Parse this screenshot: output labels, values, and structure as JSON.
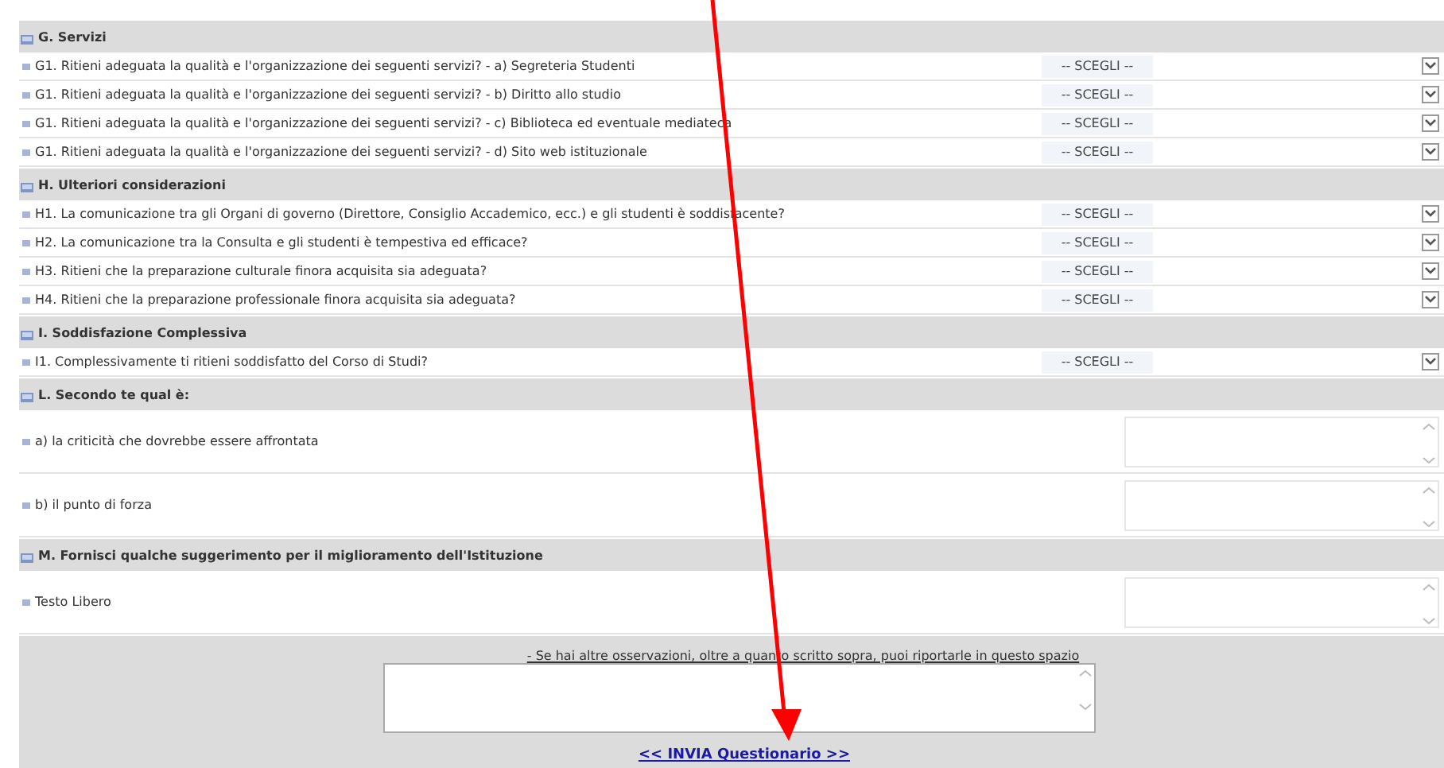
{
  "sections": [
    {
      "title": "G. Servizi",
      "questions": [
        {
          "kind": "select",
          "text": "G1. Ritieni adeguata la qualità e l'organizzazione dei seguenti servizi? - a) Segreteria Studenti",
          "value": "-- SCEGLI --"
        },
        {
          "kind": "select",
          "text": "G1. Ritieni adeguata la qualità e l'organizzazione dei seguenti servizi? - b) Diritto allo studio",
          "value": "-- SCEGLI --"
        },
        {
          "kind": "select",
          "text": "G1. Ritieni adeguata la qualità e l'organizzazione dei seguenti servizi? - c) Biblioteca ed eventuale mediateca",
          "value": "-- SCEGLI --"
        },
        {
          "kind": "select",
          "text": "G1. Ritieni adeguata la qualità e l'organizzazione dei seguenti servizi? - d) Sito web istituzionale",
          "value": "-- SCEGLI --"
        }
      ]
    },
    {
      "title": "H. Ulteriori considerazioni",
      "questions": [
        {
          "kind": "select",
          "text": "H1. La comunicazione tra gli Organi di governo (Direttore, Consiglio Accademico, ecc.) e gli studenti è soddisfacente?",
          "value": "-- SCEGLI --"
        },
        {
          "kind": "select",
          "text": "H2. La comunicazione tra la Consulta e gli studenti è tempestiva ed efficace?",
          "value": "-- SCEGLI --"
        },
        {
          "kind": "select",
          "text": "H3. Ritieni che la preparazione culturale finora acquisita sia adeguata?",
          "value": "-- SCEGLI --"
        },
        {
          "kind": "select",
          "text": "H4. Ritieni che la preparazione professionale finora acquisita sia adeguata?",
          "value": "-- SCEGLI --"
        }
      ]
    },
    {
      "title": "I. Soddisfazione Complessiva",
      "questions": [
        {
          "kind": "select",
          "text": "I1. Complessivamente ti ritieni soddisfatto del Corso di Studi?",
          "value": "-- SCEGLI --"
        }
      ]
    },
    {
      "title": "L. Secondo te qual è:",
      "questions": [
        {
          "kind": "textarea",
          "text": "a) la criticità che dovrebbe essere affrontata"
        },
        {
          "kind": "textarea",
          "text": "b) il punto di forza"
        }
      ]
    },
    {
      "title": "M. Fornisci qualche suggerimento per il miglioramento dell'Istituzione",
      "questions": [
        {
          "kind": "textarea",
          "text": "Testo Libero"
        }
      ]
    }
  ],
  "footer": {
    "label": "- Se hai altre osservazioni, oltre a quanto scritto sopra, puoi riportarle in questo spazio",
    "submit": "<< INVIA Questionario >>"
  }
}
